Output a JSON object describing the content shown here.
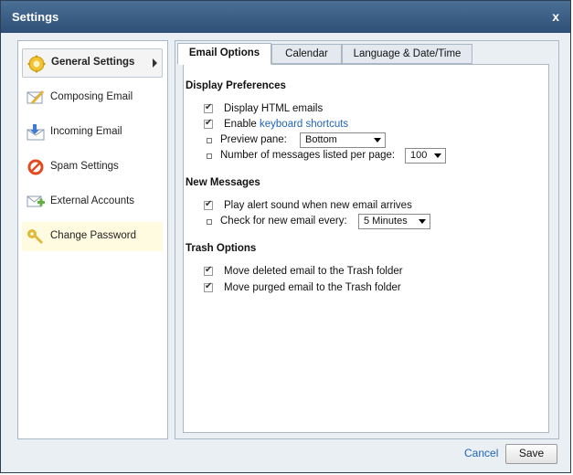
{
  "window": {
    "title": "Settings",
    "close_label": "x"
  },
  "sidebar": {
    "items": [
      {
        "label": "General Settings",
        "icon": "gear-icon",
        "color": "#f2c230"
      },
      {
        "label": "Composing Email",
        "icon": "compose-icon",
        "color": "#e3b23c"
      },
      {
        "label": "Incoming Email",
        "icon": "inbox-icon",
        "color": "#3f7bd0"
      },
      {
        "label": "Spam Settings",
        "icon": "no-entry-icon",
        "color": "#e24b1f"
      },
      {
        "label": "External Accounts",
        "icon": "add-mail-icon",
        "color": "#5fb33a"
      },
      {
        "label": "Change Password",
        "icon": "key-icon",
        "color": "#e0b93a"
      }
    ]
  },
  "tabs": [
    {
      "label": "Email Options"
    },
    {
      "label": "Calendar"
    },
    {
      "label": "Language & Date/Time"
    }
  ],
  "display": {
    "title": "Display Preferences",
    "html_emails": "Display HTML emails",
    "enable_prefix": "Enable ",
    "keyboard_link": "keyboard shortcuts",
    "preview_label": "Preview pane:",
    "preview_value": "Bottom",
    "messages_label": "Number of messages listed per page:",
    "messages_value": "100"
  },
  "new_messages": {
    "title": "New Messages",
    "alert_sound": "Play alert sound when new email arrives",
    "check_label": "Check for new email every:",
    "check_value": "5 Minutes"
  },
  "trash": {
    "title": "Trash Options",
    "move_deleted": "Move deleted email to the Trash folder",
    "move_purged": "Move purged email to the Trash folder"
  },
  "footer": {
    "cancel": "Cancel",
    "save": "Save"
  },
  "colors": {
    "titlebar": "#3a5f87",
    "link": "#1f64b8",
    "highlight": "#fffbe0"
  }
}
